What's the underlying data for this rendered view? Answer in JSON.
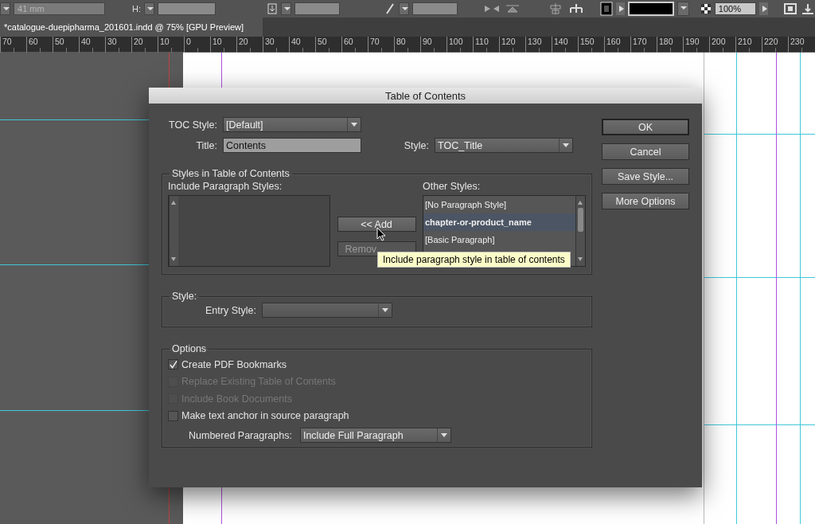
{
  "toolbar": {
    "width_field": "41 mm",
    "height_label": "H:",
    "zoom_field": "100%"
  },
  "document_tab": {
    "title": "*catalogue-duepipharma_201601.indd @ 75% [GPU Preview]",
    "selected": true
  },
  "ruler": {
    "labels": [
      "70",
      "60",
      "50",
      "40",
      "30",
      "20",
      "10",
      "0",
      "10",
      "20",
      "30",
      "40",
      "50",
      "60",
      "70",
      "80",
      "90",
      "100",
      "110",
      "120",
      "130",
      "140",
      "150",
      "160",
      "170",
      "180",
      "190",
      "200",
      "210",
      "220",
      "230"
    ]
  },
  "dialog": {
    "title": "Table of Contents",
    "toc_style": {
      "label": "TOC Style:",
      "value": "[Default]"
    },
    "title_field": {
      "label": "Title:",
      "value": "Contents"
    },
    "title_style": {
      "label": "Style:",
      "value": "TOC_Title"
    },
    "styles_group": {
      "legend": "Styles in Table of Contents",
      "include_label": "Include Paragraph Styles:",
      "add_button": "<< Add",
      "remove_button": {
        "label": "Remov",
        "disabled": true
      },
      "other_label": "Other Styles:",
      "other_styles": [
        {
          "label": "[No Paragraph Style]",
          "selected": false
        },
        {
          "label": "chapter-or-product_name",
          "selected": true
        },
        {
          "label": "[Basic Paragraph]",
          "selected": false
        }
      ]
    },
    "style_group": {
      "legend": "Style:",
      "entry_style_label": "Entry Style:"
    },
    "options": {
      "legend": "Options",
      "checkboxes": [
        {
          "label": "Create PDF Bookmarks",
          "checked": true,
          "disabled": false
        },
        {
          "label": "Replace Existing Table of Contents",
          "checked": false,
          "disabled": true
        },
        {
          "label": "Include Book Documents",
          "checked": false,
          "disabled": true
        },
        {
          "label": "Make text anchor in source paragraph",
          "checked": false,
          "disabled": false
        }
      ],
      "numbered_label": "Numbered Paragraphs:",
      "numbered_value": "Include Full Paragraph"
    },
    "buttons": [
      {
        "label": "OK",
        "default": true
      },
      {
        "label": "Cancel",
        "default": false
      },
      {
        "label": "Save Style...",
        "default": false
      },
      {
        "label": "More Options",
        "default": false
      }
    ],
    "tooltip": "Include paragraph style in table of contents"
  }
}
